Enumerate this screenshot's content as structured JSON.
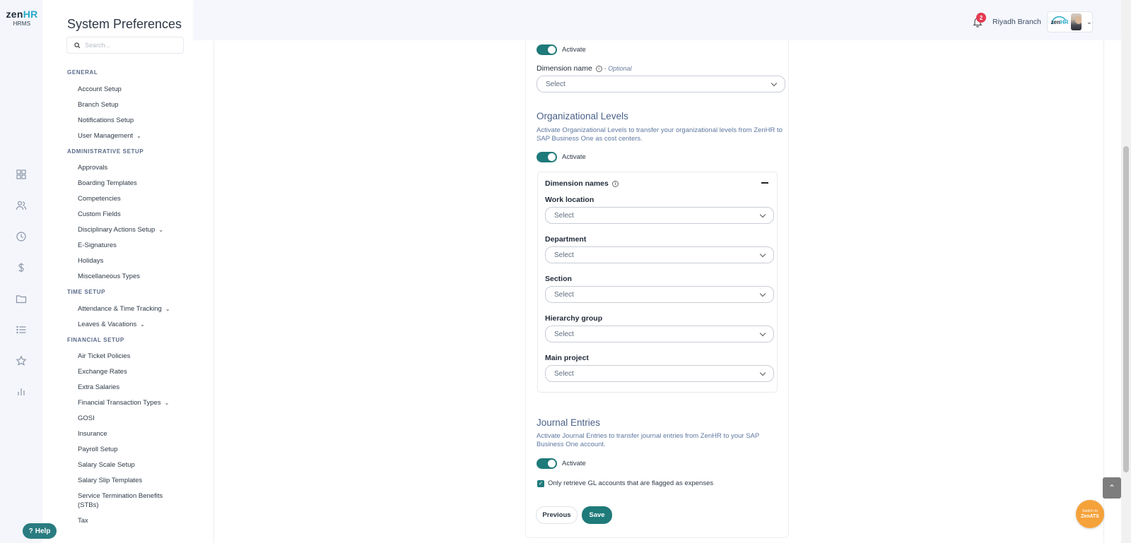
{
  "brand": {
    "name_main": "zen",
    "name_accent": "HR",
    "sub": "HRMS"
  },
  "rail_icons": [
    "dashboard-icon",
    "people-icon",
    "clock-icon",
    "dollar-icon",
    "folder-icon",
    "list-icon",
    "star-icon",
    "bar-chart-icon"
  ],
  "help": {
    "label": "Help"
  },
  "sidebar": {
    "title": "System Preferences",
    "search_placeholder": "Search...",
    "sections": [
      {
        "label": "GENERAL",
        "items": [
          "Account Setup",
          "Branch Setup",
          "Notifications Setup",
          "User Management"
        ]
      },
      {
        "label": "ADMINISTRATIVE SETUP",
        "items": [
          "Approvals",
          "Boarding Templates",
          "Competencies",
          "Custom Fields",
          "Disciplinary Actions Setup",
          "E-Signatures",
          "Holidays",
          "Miscellaneous Types"
        ]
      },
      {
        "label": "TIME SETUP",
        "items": [
          "Attendance & Time Tracking",
          "Leaves & Vacations"
        ]
      },
      {
        "label": "FINANCIAL SETUP",
        "items": [
          "Air Ticket Policies",
          "Exchange Rates",
          "Extra Salaries",
          "Financial Transaction Types",
          "GOSI",
          "Insurance",
          "Payroll Setup",
          "Salary Scale Setup",
          "Salary Slip Templates",
          "Service Termination Benefits",
          "(STBs)",
          "Tax"
        ]
      }
    ]
  },
  "header": {
    "notification_count": "2",
    "branch": "Riyadh Branch",
    "account_logo_main": "zen",
    "account_logo_accent": "HR"
  },
  "form": {
    "top_toggle_label": "Activate",
    "dimension_name_label": "Dimension name",
    "optional_label": "- Optional",
    "select_placeholder": "Select",
    "org_levels": {
      "title": "Organizational Levels",
      "description": "Activate Organizational Levels to transfer your organizational levels from ZenHR to SAP Business One as cost centers.",
      "toggle_label": "Activate",
      "dimension_names_label": "Dimension names",
      "fields": [
        "Work location",
        "Department",
        "Section",
        "Hierarchy group",
        "Main project"
      ]
    },
    "journal": {
      "title": "Journal Entries",
      "description": "Activate Journal Entries to transfer journal entries from ZenHR to your SAP Business One account.",
      "toggle_label": "Activate",
      "checkbox_label": "Only retrieve GL accounts that are flagged as expenses"
    },
    "previous_label": "Previous",
    "save_label": "Save"
  },
  "switch_ats": {
    "line1": "Switch to",
    "line2": "ZenATS"
  },
  "colors": {
    "primary": "#1f7a7a",
    "section_title": "#4a6289",
    "badge": "#e53950",
    "ats": "#f5a23b"
  }
}
